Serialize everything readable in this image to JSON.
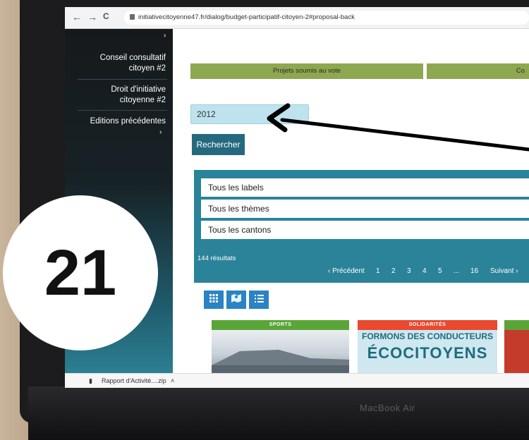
{
  "browser": {
    "url": "initiativecitoyenne47.fr/dialog/budget-participatif-citoyen-2#proposal-back",
    "back_icon": "←",
    "forward_icon": "→",
    "reload_icon": "C"
  },
  "sidebar": {
    "items": [
      {
        "label": "Conseil consultatif citoyen #2"
      },
      {
        "label": "Droit d'initiative citoyenne #2"
      },
      {
        "label": "Editions précédentes"
      }
    ],
    "arrow": "›"
  },
  "tabs": [
    {
      "label": "Projets soumis au vote"
    },
    {
      "label": "Co"
    }
  ],
  "search": {
    "value": "2012",
    "button_label": "Rechercher"
  },
  "filters": {
    "labels": "Tous les labels",
    "themes": "Tous les thèmes",
    "cantons": "Tous les cantons"
  },
  "results": {
    "count_text": "144 résultats"
  },
  "pagination": {
    "prev": "‹ Précédent",
    "pages": [
      "1",
      "2",
      "3",
      "4",
      "5"
    ],
    "ellipsis": "...",
    "last": "16",
    "next": "Suivant ›"
  },
  "view_buttons": [
    {
      "icon": "grid-icon"
    },
    {
      "icon": "map-icon"
    },
    {
      "icon": "list-icon"
    }
  ],
  "cards": [
    {
      "tag": "SPORTS",
      "tag_color": "#5aa537"
    },
    {
      "tag": "SOLIDARITÉS",
      "tag_color": "#e8492f",
      "title_small": "FORMONS DES CONDUCTEURS",
      "title_big": "ÉCOCITOYENS"
    }
  ],
  "downloads": {
    "file": "Rapport d'Activité....zip"
  },
  "annotation": {
    "step_number": "21"
  },
  "device": {
    "brand": "MacBook Air"
  }
}
